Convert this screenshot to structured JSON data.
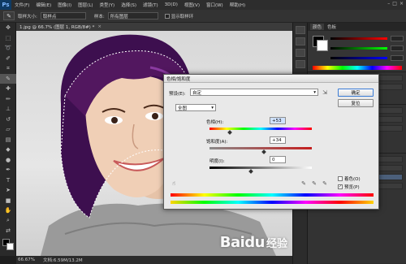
{
  "app": {
    "logo": "Ps",
    "menu": [
      "文件(F)",
      "编辑(E)",
      "图像(I)",
      "图层(L)",
      "类型(Y)",
      "选择(S)",
      "滤镜(T)",
      "3D(D)",
      "视图(V)",
      "窗口(W)",
      "帮助(H)"
    ],
    "window_controls": [
      "–",
      "□",
      "×"
    ]
  },
  "options_bar": {
    "sample_size_label": "取样大小:",
    "sample_size_value": "取样点",
    "sample_label": "样本:",
    "sample_value": "所有图层",
    "show_ring_label": "显示取样环"
  },
  "toolbar": {
    "tools": [
      "move-tool",
      "marquee-tool",
      "lasso-tool",
      "quick-select-tool",
      "crop-tool",
      "eyedropper-tool",
      "healing-tool",
      "brush-tool",
      "stamp-tool",
      "history-brush-tool",
      "eraser-tool",
      "gradient-tool",
      "blur-tool",
      "dodge-tool",
      "pen-tool",
      "type-tool",
      "path-select-tool",
      "shape-tool",
      "hand-tool",
      "zoom-tool"
    ]
  },
  "document": {
    "tab_title": "1.jpg @ 66.7% (图层 1, RGB/8#) *",
    "close": "×"
  },
  "statusbar": {
    "zoom": "66.67%",
    "doc_info": "文档:6.59M/13.2M"
  },
  "panels": {
    "tabs": [
      "颜色",
      "色板"
    ]
  },
  "dialog": {
    "title": "色相/饱和度",
    "preset_label": "预设(E):",
    "preset_value": "自定",
    "channel_value": "全图",
    "hue_label": "色相(H):",
    "hue_value": "+53",
    "saturation_label": "饱和度(A):",
    "saturation_value": "+34",
    "lightness_label": "明度(I):",
    "lightness_value": "0",
    "ok_label": "确定",
    "reset_label": "复位",
    "colorize_label": "着色(O)",
    "preview_label": "预览(P)",
    "colorize_checked": false,
    "preview_checked": true
  },
  "watermark": {
    "text": "Baidu",
    "sub": "经验"
  },
  "colors": {
    "hair_purple": "#4a1460",
    "selection_border": "#ffffff",
    "dialog_bg": "#e9e9e9",
    "accent_blue": "#3a7bd5"
  }
}
